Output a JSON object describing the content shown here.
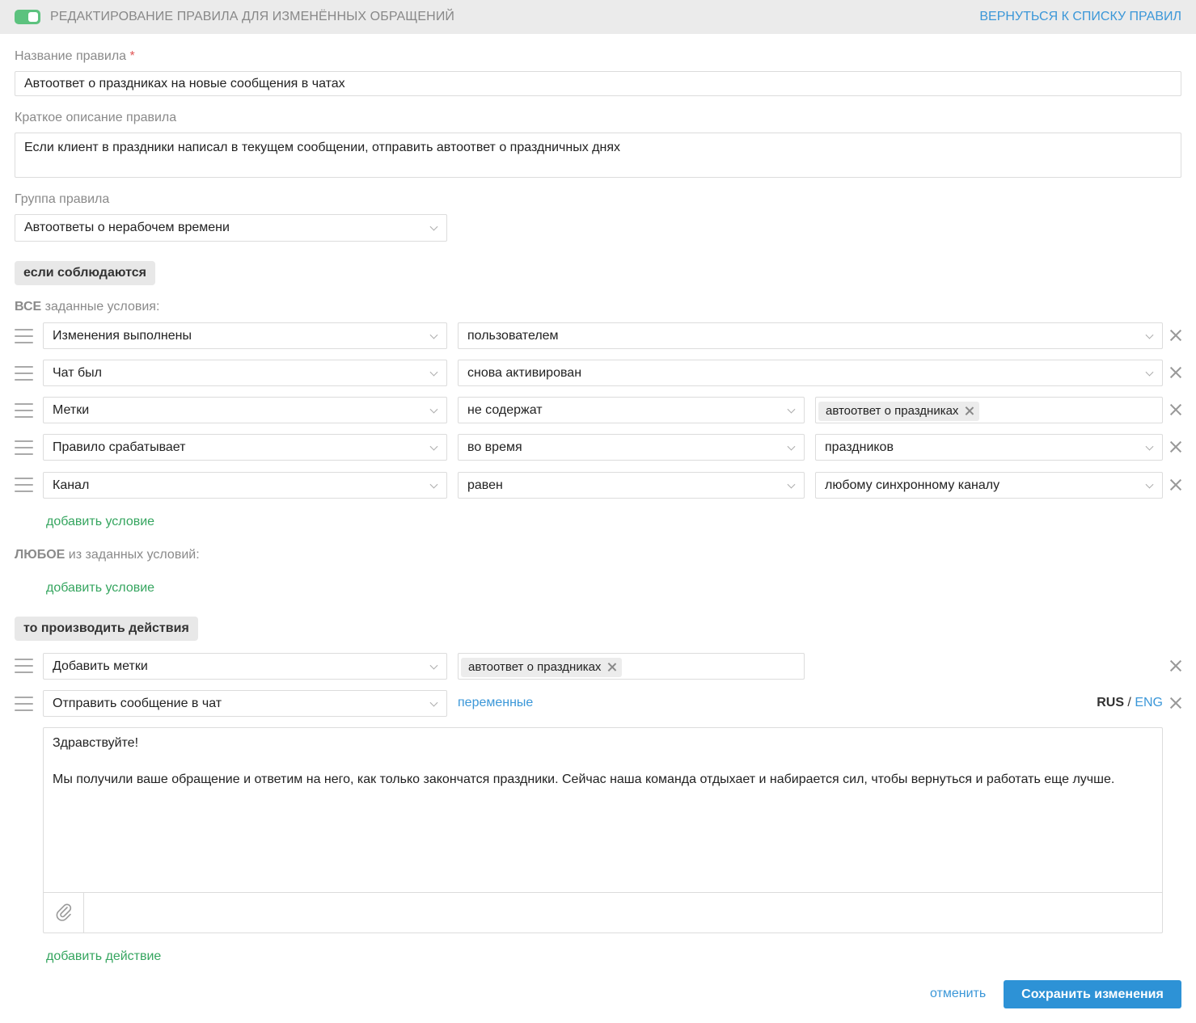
{
  "header": {
    "title": "РЕДАКТИРОВАНИЕ ПРАВИЛА ДЛЯ ИЗМЕНЁННЫХ ОБРАЩЕНИЙ",
    "back_link": "ВЕРНУТЬСЯ К СПИСКУ ПРАВИЛ",
    "toggle_on": true
  },
  "form": {
    "name_label": "Название правила",
    "name_required_mark": "*",
    "name_value": "Автоответ о праздниках на новые сообщения в чатах",
    "description_label": "Краткое описание правила",
    "description_value": "Если клиент в праздники написал в текущем сообщении, отправить автоответ о праздничных днях",
    "group_label": "Группа правила",
    "group_value": "Автоответы о нерабочем времени"
  },
  "conditions": {
    "section_label": "если соблюдаются",
    "all_bold": "ВСЕ",
    "all_rest": " заданные условия:",
    "rows": [
      {
        "field": "Изменения выполнены",
        "operator": "пользователем"
      },
      {
        "field": "Чат был",
        "operator": "снова активирован"
      },
      {
        "field": "Метки",
        "operator": "не содержат",
        "tag": "автоответ о праздниках"
      },
      {
        "field": "Правило срабатывает",
        "operator": "во время",
        "value": "праздников"
      },
      {
        "field": "Канал",
        "operator": "равен",
        "value": "любому синхронному каналу"
      }
    ],
    "add_condition": "добавить условие",
    "any_bold": "ЛЮБОЕ",
    "any_rest": " из заданных условий:",
    "add_condition_any": "добавить условие"
  },
  "actions": {
    "section_label": "то производить действия",
    "row1_action": "Добавить метки",
    "row1_tag": "автоответ о праздниках",
    "row2_action": "Отправить сообщение в чат",
    "variables_link": "переменные",
    "lang_rus": "RUS",
    "lang_sep": " / ",
    "lang_eng": "ENG",
    "message_text": "Здравствуйте!\n\nМы получили ваше обращение и ответим на него, как только закончатся праздники. Сейчас наша команда отдыхает и набирается сил, чтобы вернуться и работать еще лучше.",
    "add_action": "добавить действие"
  },
  "footer": {
    "cancel": "отменить",
    "save": "Сохранить изменения"
  },
  "colors": {
    "accent_blue": "#2d92d6",
    "link_green": "#35a55f",
    "toggle_green": "#5cc27e"
  }
}
